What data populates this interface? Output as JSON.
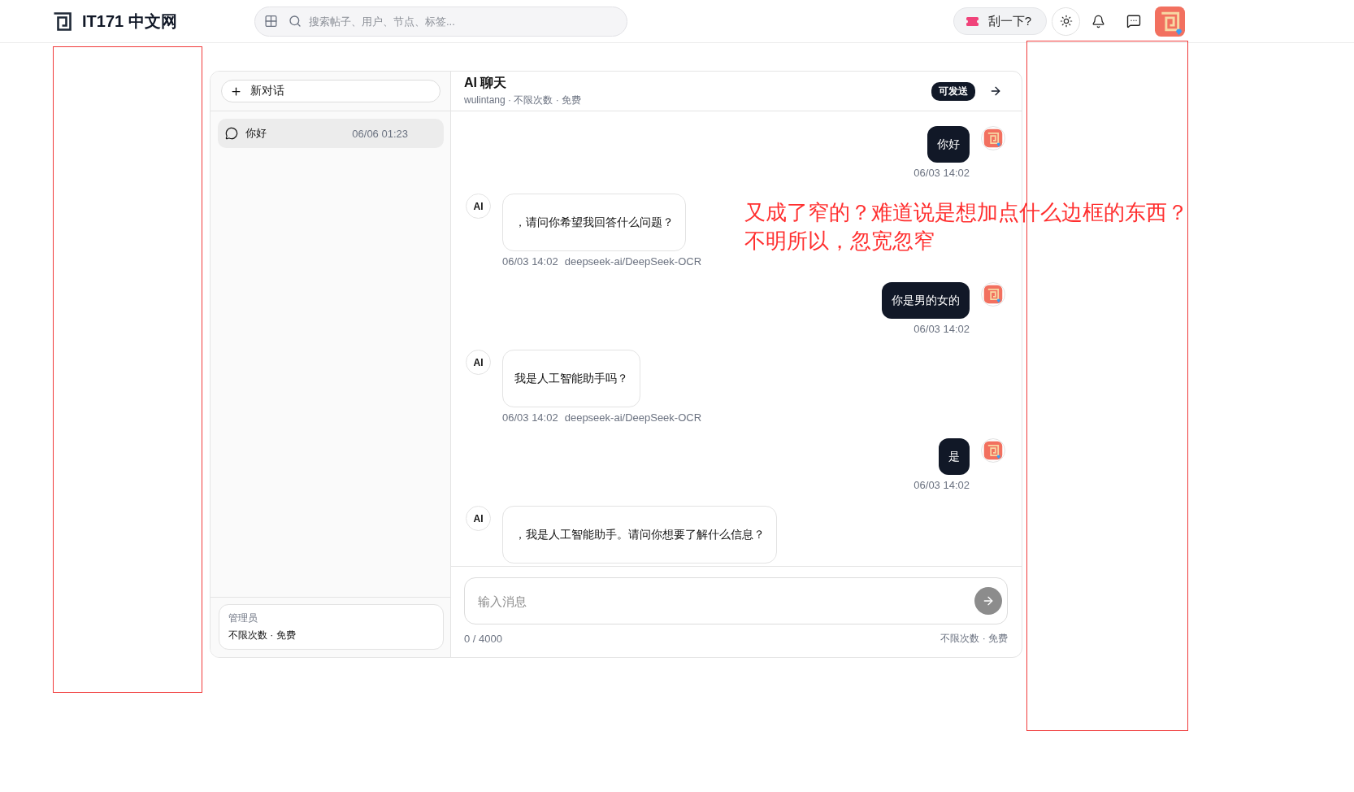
{
  "header": {
    "site_title": "IT171 中文网",
    "search": {
      "placeholder": "搜索帖子、用户、节点、标签..."
    },
    "scratch_button": "刮一下?"
  },
  "sidebar": {
    "new_chat_button": "新对话",
    "conversations": [
      {
        "title": "你好",
        "time": "06/06 01:23",
        "selected": true
      }
    ],
    "account": {
      "role": "管理员",
      "quota": "不限次数 · 免费"
    }
  },
  "chat": {
    "title": "AI 聊天",
    "subtitle": "wulintang · 不限次数 · 免费",
    "status_badge": "可发送",
    "messages": [
      {
        "kind": "user",
        "text": "你好",
        "time": "06/03 14:02"
      },
      {
        "kind": "ai",
        "avatar_label": "AI",
        "text": "，请问你希望我回答什么问题？",
        "time": "06/03 14:02",
        "model": "deepseek-ai/DeepSeek-OCR"
      },
      {
        "kind": "user",
        "text": "你是男的女的",
        "time": "06/03 14:02"
      },
      {
        "kind": "ai",
        "avatar_label": "AI",
        "text": "我是人工智能助手吗？",
        "time": "06/03 14:02",
        "model": "deepseek-ai/DeepSeek-OCR"
      },
      {
        "kind": "user",
        "text": "是",
        "time": "06/03 14:02"
      },
      {
        "kind": "ai",
        "avatar_label": "AI",
        "text": "，我是人工智能助手。请问你想要了解什么信息？"
      }
    ],
    "composer": {
      "placeholder": "输入消息",
      "counter": "0 / 4000",
      "quota": "不限次数 · 免费"
    }
  },
  "annotation": {
    "lines": [
      "又成了窄的？难道说是想加点什么边框的东西？",
      "不明所以，忽宽忽窄"
    ]
  }
}
